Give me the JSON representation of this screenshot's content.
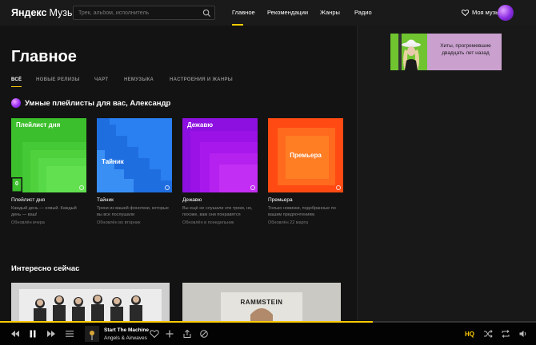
{
  "header": {
    "logo_part1": "Яндекс",
    "logo_part2": "Музыка",
    "search_placeholder": "Трек, альбом, исполнитель",
    "nav": [
      "Главное",
      "Рекомендации",
      "Жанры",
      "Радио"
    ],
    "my_music": "Моя музыка"
  },
  "ad": {
    "text": "Хиты, прогремевшие двадцать лет назад"
  },
  "page": {
    "title": "Главное",
    "tabs": [
      "ВСЁ",
      "НОВЫЕ РЕЛИЗЫ",
      "ЧАРТ",
      "НЕМУЗЫКА",
      "НАСТРОЕНИЯ И ЖАНРЫ"
    ]
  },
  "smart": {
    "title": "Умные плейлисты для вас, Александр",
    "cards": [
      {
        "cover_title": "Плейлист дня",
        "badge": "0",
        "name": "Плейлист дня",
        "desc": "Каждый день — новый. Каждый день — ваш!",
        "updated": "Обновлён вчера",
        "color": "#3cbf2c"
      },
      {
        "cover_title": "Тайник",
        "name": "Тайник",
        "desc": "Треки из вашей фонотеки, которые вы все послушали",
        "updated": "Обновлён во вторник",
        "color": "#2a7ee8"
      },
      {
        "cover_title": "Дежавю",
        "name": "Дежавю",
        "desc": "Вы ещё не слушали эти треки, но, похоже, вам они понравятся",
        "updated": "Обновлён в понедельник",
        "color": "#a40fe8"
      },
      {
        "cover_title": "Премьера",
        "name": "Премьера",
        "desc": "Только новинки, подобранные по вашим предпочтениям",
        "updated": "Обновлён 22 марта",
        "color": "#ff5a14"
      }
    ]
  },
  "interesting": {
    "title": "Интересно сейчас",
    "album2_text": "RAMMSTEIN"
  },
  "player": {
    "track": "Start The Machine",
    "artist": "Angels & Airwaves",
    "quality": "HQ",
    "progress": 0.695
  }
}
